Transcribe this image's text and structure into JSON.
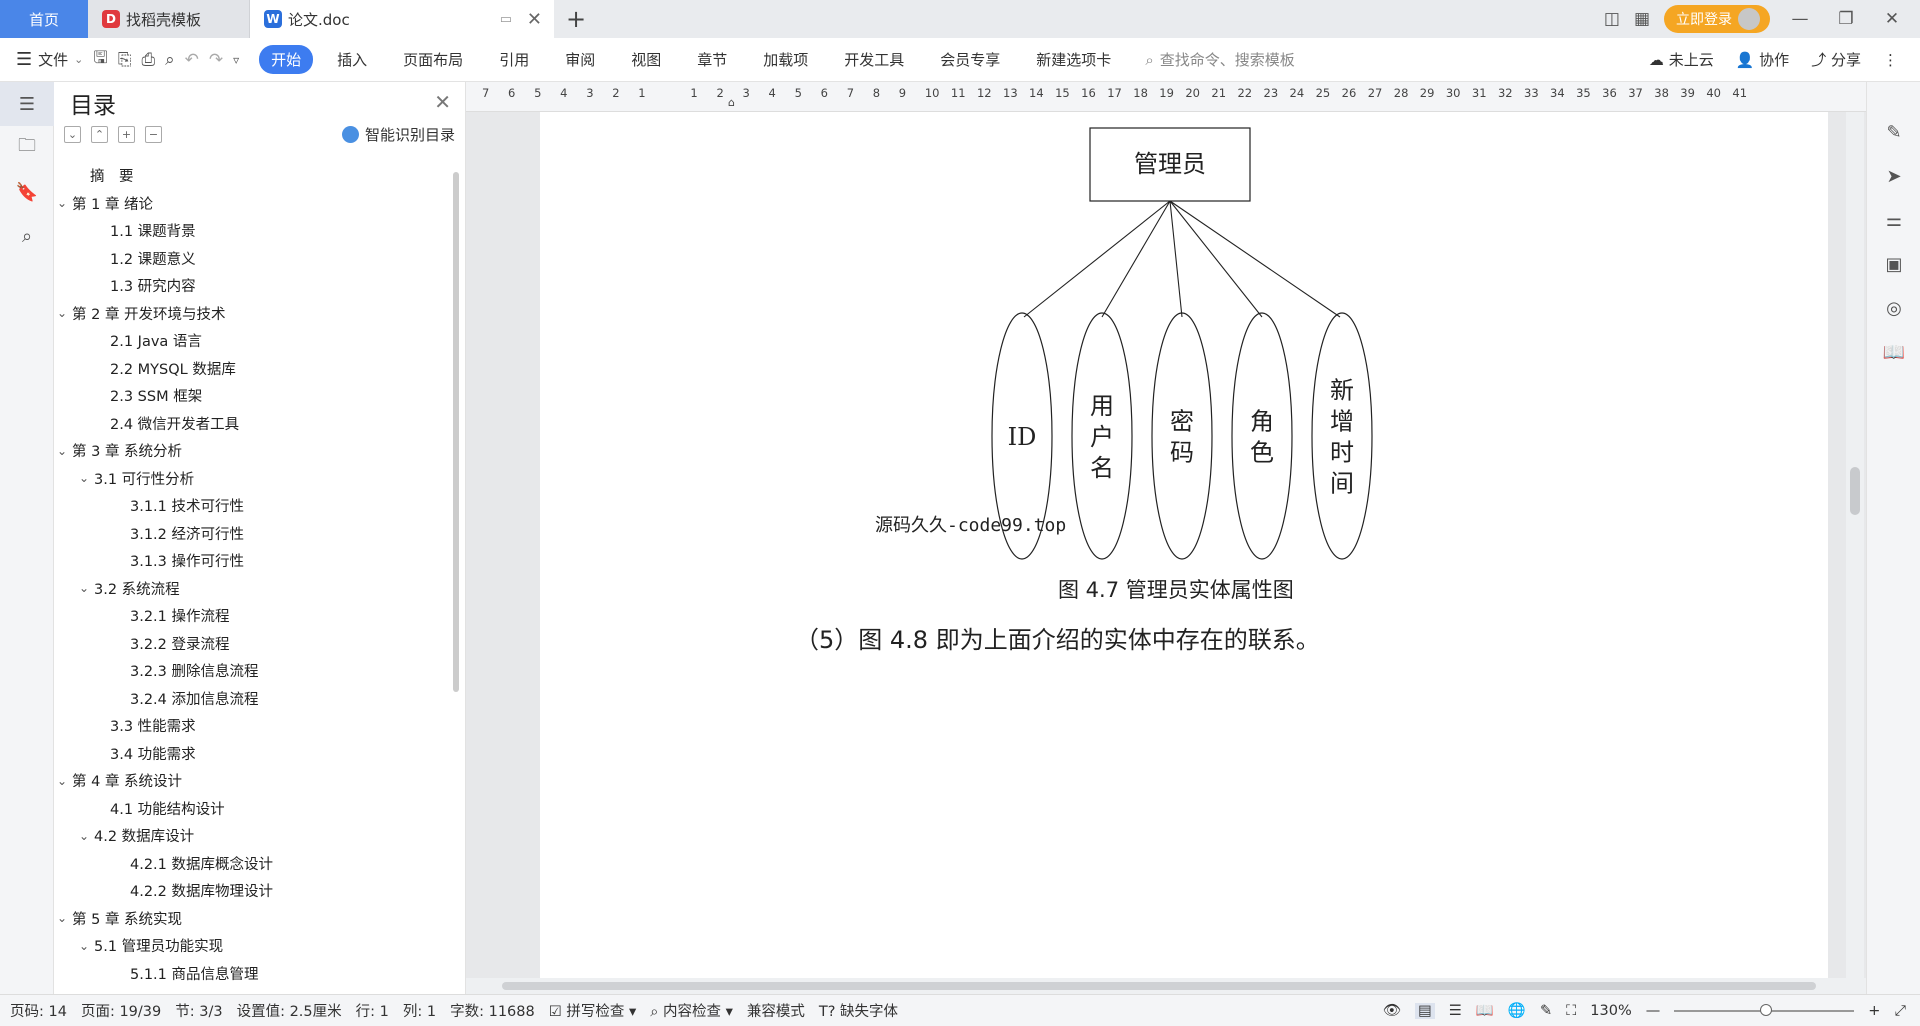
{
  "tabs": [
    {
      "label": "首页",
      "icon": ""
    },
    {
      "label": "找稻壳模板",
      "icon": "docer-icon"
    },
    {
      "label": "论文.doc",
      "icon": "wps-writer-icon"
    }
  ],
  "titlebar_right": {
    "login": "立即登录"
  },
  "ribbon": {
    "file": "文件",
    "tabs": [
      "开始",
      "插入",
      "页面布局",
      "引用",
      "审阅",
      "视图",
      "章节",
      "加载项",
      "开发工具",
      "会员专享",
      "新建选项卡"
    ],
    "active_tab": "开始",
    "search_placeholder": "查找命令、搜索模板",
    "cloud": "未上云",
    "collab": "协作",
    "share": "分享"
  },
  "toc": {
    "title": "目录",
    "smart_label": "智能识别目录",
    "items": [
      {
        "label": "摘　要",
        "level": 1,
        "chev": ""
      },
      {
        "label": "第 1 章  绪论",
        "level": 1,
        "chev": "v"
      },
      {
        "label": "1.1  课题背景",
        "level": 2,
        "chev": ""
      },
      {
        "label": "1.2  课题意义",
        "level": 2,
        "chev": ""
      },
      {
        "label": "1.3  研究内容",
        "level": 2,
        "chev": ""
      },
      {
        "label": "第 2 章  开发环境与技术",
        "level": 1,
        "chev": "v"
      },
      {
        "label": "2.1 Java 语言",
        "level": 2,
        "chev": ""
      },
      {
        "label": "2.2 MYSQL 数据库",
        "level": 2,
        "chev": ""
      },
      {
        "label": "2.3 SSM 框架",
        "level": 2,
        "chev": ""
      },
      {
        "label": "2.4 微信开发者工具",
        "level": 2,
        "chev": ""
      },
      {
        "label": "第 3 章  系统分析",
        "level": 1,
        "chev": "v"
      },
      {
        "label": "3.1  可行性分析",
        "level": 2,
        "chev": "v"
      },
      {
        "label": "3.1.1  技术可行性",
        "level": 3,
        "chev": ""
      },
      {
        "label": "3.1.2  经济可行性",
        "level": 3,
        "chev": ""
      },
      {
        "label": "3.1.3  操作可行性",
        "level": 3,
        "chev": ""
      },
      {
        "label": "3.2  系统流程",
        "level": 2,
        "chev": "v"
      },
      {
        "label": "3.2.1  操作流程",
        "level": 3,
        "chev": ""
      },
      {
        "label": "3.2.2  登录流程",
        "level": 3,
        "chev": ""
      },
      {
        "label": "3.2.3  删除信息流程",
        "level": 3,
        "chev": ""
      },
      {
        "label": "3.2.4  添加信息流程",
        "level": 3,
        "chev": ""
      },
      {
        "label": "3.3  性能需求",
        "level": 2,
        "chev": ""
      },
      {
        "label": "3.4  功能需求",
        "level": 2,
        "chev": ""
      },
      {
        "label": "第 4 章  系统设计",
        "level": 1,
        "chev": "v"
      },
      {
        "label": "4.1  功能结构设计",
        "level": 2,
        "chev": ""
      },
      {
        "label": "4.2  数据库设计",
        "level": 2,
        "chev": "v"
      },
      {
        "label": "4.2.1  数据库概念设计",
        "level": 3,
        "chev": ""
      },
      {
        "label": "4.2.2  数据库物理设计",
        "level": 3,
        "chev": ""
      },
      {
        "label": "第 5 章  系统实现",
        "level": 1,
        "chev": "v"
      },
      {
        "label": "5.1  管理员功能实现",
        "level": 2,
        "chev": "v"
      },
      {
        "label": "5.1.1  商品信息管理",
        "level": 3,
        "chev": ""
      }
    ]
  },
  "ruler": {
    "labels": [
      "7",
      "6",
      "5",
      "4",
      "3",
      "2",
      "1",
      "",
      "1",
      "2",
      "3",
      "4",
      "5",
      "6",
      "7",
      "8",
      "9",
      "10",
      "11",
      "12",
      "13",
      "14",
      "15",
      "16",
      "17",
      "18",
      "19",
      "20",
      "21",
      "22",
      "23",
      "24",
      "25",
      "26",
      "27",
      "28",
      "29",
      "30",
      "31",
      "32",
      "33",
      "34",
      "35",
      "36",
      "37",
      "38",
      "39",
      "40",
      "41"
    ]
  },
  "diagram": {
    "entity": "管理员",
    "attributes": [
      "ID",
      "用户名",
      "密码",
      "角色",
      "新增时间"
    ],
    "watermark": "源码久久-code99.top",
    "caption": "图 4.7  管理员实体属性图",
    "body": "（5）图 4.8 即为上面介绍的实体中存在的联系。"
  },
  "status": {
    "page_code": "页码: 14",
    "pages": "页面: 19/39",
    "section": "节: 3/3",
    "setting": "设置值: 2.5厘米",
    "row": "行: 1",
    "col": "列: 1",
    "words": "字数: 11688",
    "spell": "拼写检查",
    "content_check": "内容检查",
    "compat": "兼容模式",
    "missing_font": "缺失字体",
    "zoom": "130%"
  }
}
